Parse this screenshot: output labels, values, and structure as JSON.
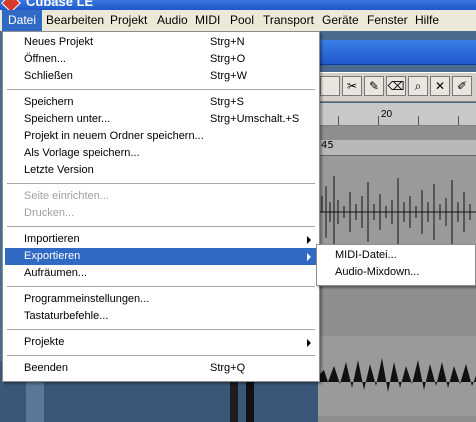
{
  "window": {
    "title": "Cubase LE"
  },
  "menubar": {
    "items": [
      "Datei",
      "Bearbeiten",
      "Projekt",
      "Audio",
      "MIDI",
      "Pool",
      "Transport",
      "Geräte",
      "Fenster",
      "Hilfe"
    ],
    "active": "Datei"
  },
  "datei_menu": {
    "items": [
      {
        "label": "Neues Projekt",
        "shortcut": "Strg+N"
      },
      {
        "label": "Öffnen...",
        "shortcut": "Strg+O"
      },
      {
        "label": "Schließen",
        "shortcut": "Strg+W"
      },
      {
        "label": "Speichern",
        "shortcut": "Strg+S"
      },
      {
        "label": "Speichern unter...",
        "shortcut": "Strg+Umschalt.+S"
      },
      {
        "label": "Projekt in neuem Ordner speichern...",
        "shortcut": ""
      },
      {
        "label": "Als Vorlage speichern...",
        "shortcut": ""
      },
      {
        "label": "Letzte Version",
        "shortcut": ""
      },
      {
        "label": "Seite einrichten...",
        "shortcut": "",
        "disabled": true
      },
      {
        "label": "Drucken...",
        "shortcut": "",
        "disabled": true
      },
      {
        "label": "Importieren",
        "shortcut": "",
        "submenu": true
      },
      {
        "label": "Exportieren",
        "shortcut": "",
        "submenu": true,
        "highlighted": true
      },
      {
        "label": "Aufräumen...",
        "shortcut": ""
      },
      {
        "label": "Programmeinstellungen...",
        "shortcut": ""
      },
      {
        "label": "Tastaturbefehle...",
        "shortcut": ""
      },
      {
        "label": "Projekte",
        "shortcut": "",
        "submenu": true
      },
      {
        "label": "Beenden",
        "shortcut": "Strg+Q"
      }
    ]
  },
  "export_submenu": {
    "items": [
      "MIDI-Datei...",
      "Audio-Mixdown..."
    ]
  },
  "project": {
    "ruler_mark": "20",
    "track_position": "45"
  },
  "colors": {
    "menu_highlight": "#316ac5",
    "menubar_bg": "#ece9d8",
    "titlebar": "#1d56c9"
  }
}
